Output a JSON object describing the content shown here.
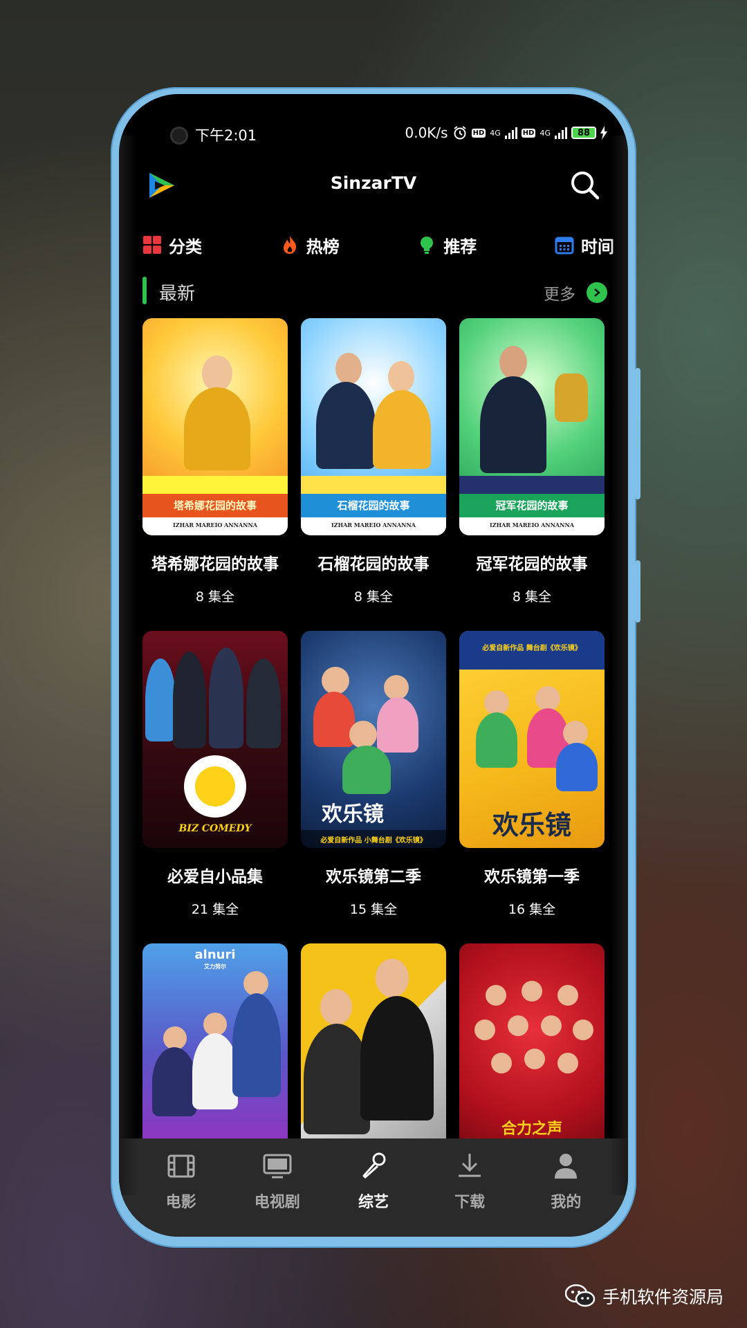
{
  "status_bar": {
    "time": "下午2:01",
    "network_speed": "0.0K/s",
    "hd_1": "HD",
    "net_1": "4G",
    "hd_2": "HD",
    "net_2": "4G",
    "battery": "88"
  },
  "header": {
    "title": "SinzarTV"
  },
  "categories": [
    {
      "label": "分类",
      "icon": "grid-icon",
      "color": "#e8383d"
    },
    {
      "label": "热榜",
      "icon": "flame-icon",
      "color": "#ff5a1f"
    },
    {
      "label": "推荐",
      "icon": "lightbulb-icon",
      "color": "#2fc24d"
    },
    {
      "label": "时间",
      "icon": "calendar-icon",
      "color": "#2f7cf0"
    }
  ],
  "section": {
    "title": "最新",
    "more_label": "更多"
  },
  "items": [
    {
      "title": "塔希娜花园的故事",
      "episodes": "8 集全",
      "poster_text": "塔希娜花园的故事",
      "poster_credits": "IZHAR  MAREIO  ANNANNA"
    },
    {
      "title": "石榴花园的故事",
      "episodes": "8 集全",
      "poster_text": "石榴花园的故事",
      "poster_credits": "IZHAR  MAREIO  ANNANNA"
    },
    {
      "title": "冠军花园的故事",
      "episodes": "8 集全",
      "poster_text": "冠军花园的故事",
      "poster_credits": "IZHAR  MAREIO  ANNANNA"
    },
    {
      "title": "必爱自小品集",
      "episodes": "21 集全",
      "poster_text": "BIZ COMEDY"
    },
    {
      "title": "欢乐镜第二季",
      "episodes": "15 集全",
      "poster_text": "欢乐镜",
      "poster_caption": "必爱自新作品 小舞台剧《欢乐镜》"
    },
    {
      "title": "欢乐镜第一季",
      "episodes": "16 集全",
      "poster_text": "欢乐镜",
      "poster_caption": "必爱自新作品 舞台剧《欢乐镜》"
    },
    {
      "title": "",
      "episodes": "",
      "poster_text": "alnuri",
      "poster_caption": "艾力努尔"
    },
    {
      "title": "",
      "episodes": "",
      "poster_text": ""
    },
    {
      "title": "",
      "episodes": "",
      "poster_text": "合力之声"
    }
  ],
  "bottom_nav": [
    {
      "label": "电影",
      "icon": "film-icon",
      "active": false
    },
    {
      "label": "电视剧",
      "icon": "tv-icon",
      "active": false
    },
    {
      "label": "综艺",
      "icon": "microphone-icon",
      "active": true
    },
    {
      "label": "下载",
      "icon": "download-icon",
      "active": false
    },
    {
      "label": "我的",
      "icon": "user-icon",
      "active": false
    }
  ],
  "watermark": {
    "text": "手机软件资源局"
  },
  "colors": {
    "accent_green": "#2fc24d",
    "nav_bg": "#2a2a2a",
    "frame_blue": "#7fbfe8"
  }
}
